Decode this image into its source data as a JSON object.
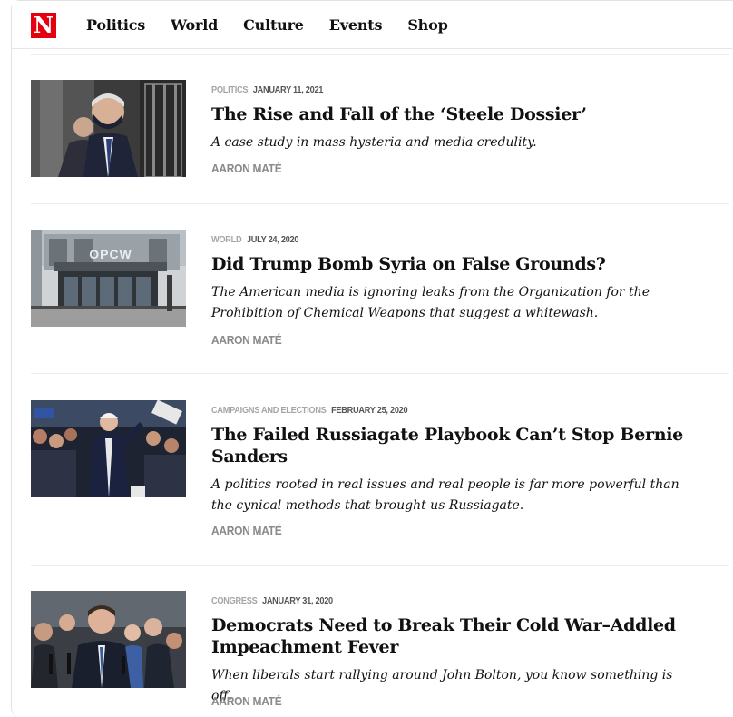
{
  "logo": {
    "letter": "N"
  },
  "nav": [
    "Politics",
    "World",
    "Culture",
    "Events",
    "Shop"
  ],
  "articles": [
    {
      "category": "POLITICS",
      "date": "JANUARY 11, 2021",
      "title": "The Rise and Fall of the ‘Steele Dossier’",
      "dek": "A case study in mass hysteria and media credulity.",
      "author": "AARON MATÉ"
    },
    {
      "category": "WORLD",
      "date": "JULY 24, 2020",
      "title": "Did Trump Bomb Syria on False Grounds?",
      "dek": "The American media is ignoring leaks from the Organization for the Prohibition of Chemical Weapons that suggest a whitewash.",
      "author": "AARON MATÉ",
      "image_sign": "OPCW"
    },
    {
      "category": "CAMPAIGNS AND ELECTIONS",
      "date": "FEBRUARY 25, 2020",
      "title": "The Failed Russiagate Playbook Can’t Stop Bernie Sanders",
      "dek": "A politics rooted in real issues and real people is far more powerful than the cynical methods that brought us Russiagate.",
      "author": "AARON MATÉ"
    },
    {
      "category": "CONGRESS",
      "date": "JANUARY 31, 2020",
      "title": "Democrats Need to Break Their Cold War–Addled Impeachment Fever",
      "dek": "When liberals start rallying around John Bolton, you know something is off.",
      "author": "AARON MATÉ"
    }
  ],
  "colors": {
    "brand": "#e3000f",
    "category": "#a5a5a5",
    "date": "#555555",
    "author": "#8a8a8a"
  }
}
